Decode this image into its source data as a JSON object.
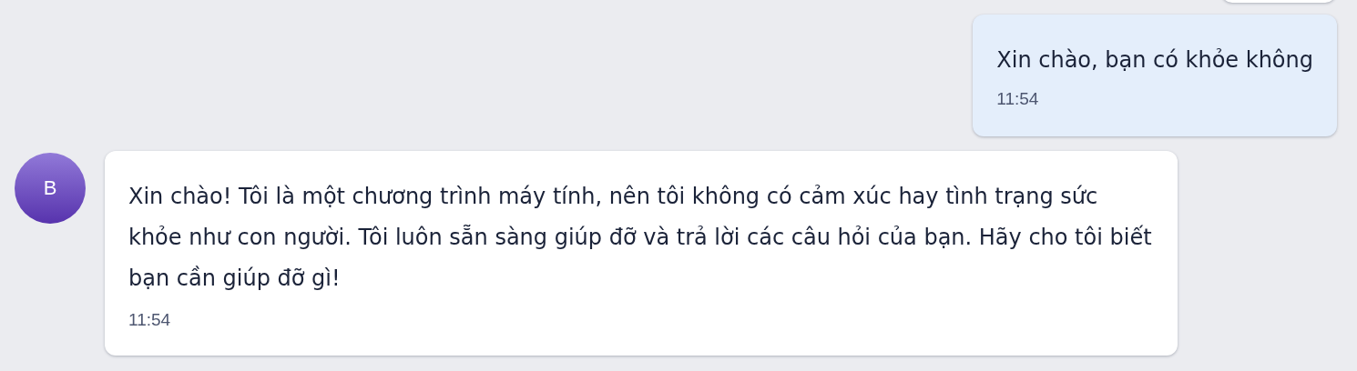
{
  "messages": [
    {
      "kind": "user",
      "text": "Xin chào, bạn có khỏe không",
      "time": "11:54"
    },
    {
      "kind": "bot",
      "avatar": "B",
      "text": "Xin chào! Tôi là một chương trình máy tính, nên tôi không có cảm xúc hay tình trạng sức khỏe như con người. Tôi luôn sẵn sàng giúp đỡ và trả lời các câu hỏi của bạn. Hãy cho tôi biết bạn cần giúp đỡ gì!",
      "time": "11:54"
    }
  ]
}
